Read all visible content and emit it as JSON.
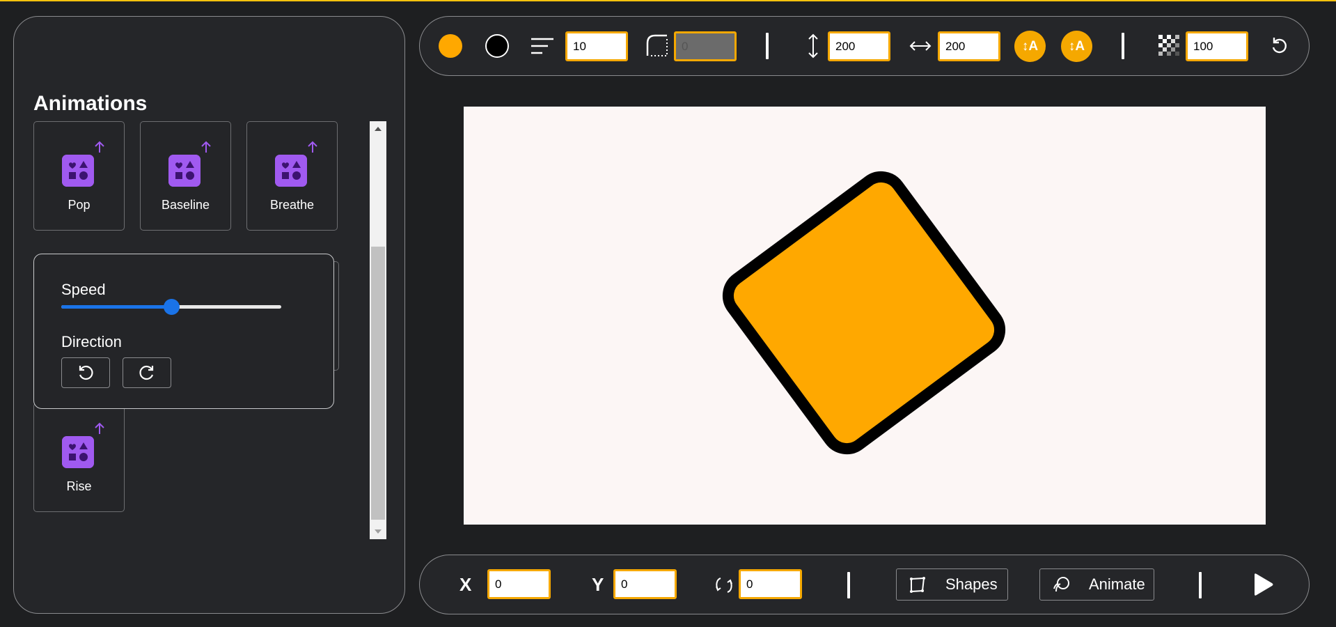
{
  "sidebar": {
    "title": "Animations",
    "animations": [
      {
        "label": "Pop"
      },
      {
        "label": "Baseline"
      },
      {
        "label": "Breathe"
      },
      {
        "label": "Rise"
      }
    ],
    "options_popover": {
      "speed_label": "Speed",
      "speed_value": 0.5,
      "direction_label": "Direction",
      "direction_buttons": [
        "rotate-counterclockwise-icon",
        "rotate-clockwise-icon"
      ]
    }
  },
  "toolbar": {
    "fill_color": "#ffa800",
    "stroke_color": "#000000",
    "stroke_width": "10",
    "corner_radius": "0",
    "height": "200",
    "width": "200",
    "height_lock_text": "↕A",
    "width_lock_text": "↕A",
    "opacity": "100"
  },
  "canvas": {
    "background": "#fcf6f5",
    "shape": {
      "type": "rounded-square",
      "fill": "#ffa800",
      "stroke": "#000000"
    }
  },
  "bottombar": {
    "x_label": "X",
    "x_value": "0",
    "y_label": "Y",
    "y_value": "0",
    "rotation_value": "0",
    "shapes_label": "Shapes",
    "animate_label": "Animate"
  },
  "colors": {
    "accent": "#f5a800",
    "purple": "#a05af0",
    "blue": "#1a73e8"
  }
}
